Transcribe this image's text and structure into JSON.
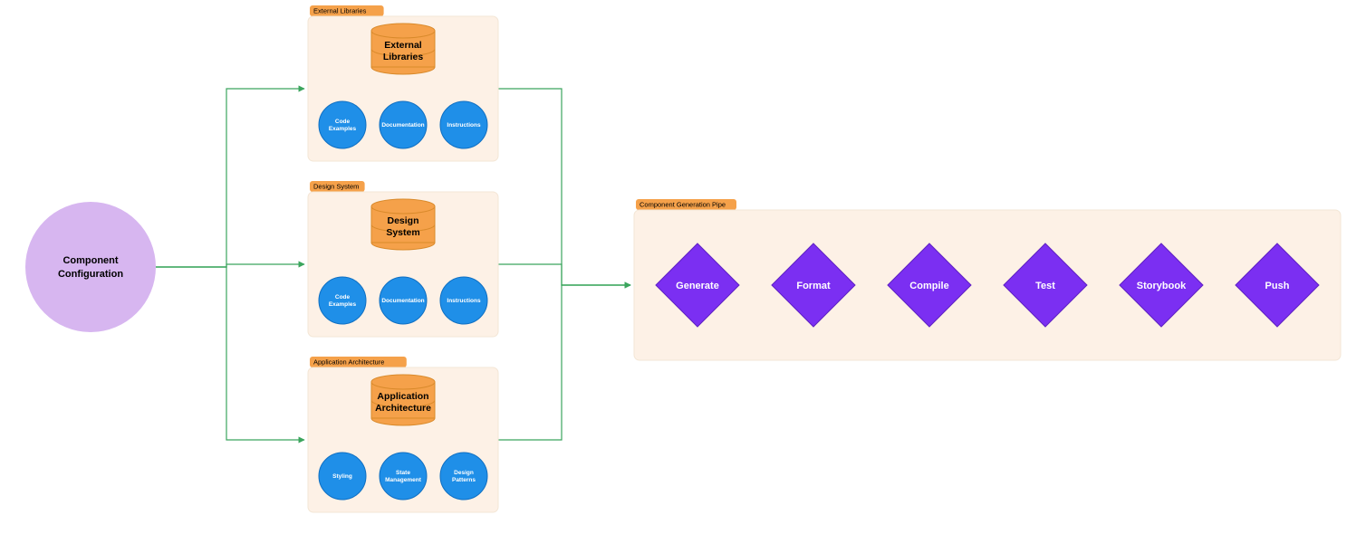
{
  "start_node": {
    "label_l1": "Component",
    "label_l2": "Configuration"
  },
  "db_groups": [
    {
      "tag": "External Libraries",
      "db_label_l1": "External",
      "db_label_l2": "Libraries",
      "children": [
        "Code Examples",
        "Documentation",
        "Instructions"
      ]
    },
    {
      "tag": "Design System",
      "db_label_l1": "Design",
      "db_label_l2": "System",
      "children": [
        "Code Examples",
        "Documentation",
        "Instructions"
      ]
    },
    {
      "tag": "Application Architecture",
      "db_label_l1": "Application",
      "db_label_l2": "Architecture",
      "children": [
        "Styling",
        "State Management",
        "Design Patterns"
      ]
    }
  ],
  "pipeline": {
    "tag": "Component Generation Pipe",
    "steps": [
      "Generate",
      "Format",
      "Compile",
      "Test",
      "Storybook",
      "Push"
    ]
  },
  "colors": {
    "start_fill": "#d7b6f0",
    "group_bg": "#fdf1e6",
    "group_border": "#f3e6d6",
    "tag_bg": "#f5a14a",
    "db_fill": "#f5a14a",
    "db_stroke": "#d98a2b",
    "child_fill": "#1f8fe8",
    "child_stroke": "#0f6fc2",
    "diamond_fill": "#7b2ff2",
    "diamond_stroke": "#5e20c2",
    "edge_green": "#3ba55d",
    "edge_gray": "#9a9a9a"
  }
}
